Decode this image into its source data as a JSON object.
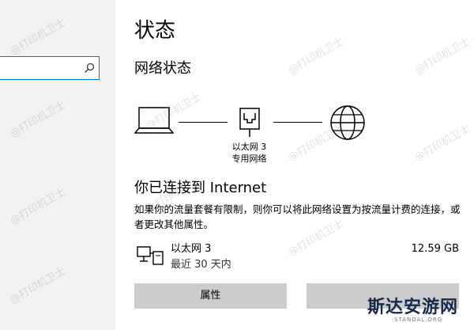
{
  "page": {
    "title": "状态",
    "section_title": "网络状态"
  },
  "diagram": {
    "adapter_name": "以太网 3",
    "network_type": "专用网络"
  },
  "status": {
    "heading": "你已连接到 Internet",
    "description": "如果你的流量套餐有限制，则你可以将此网络设置为按流量计费的连接，或者更改其他属性。"
  },
  "usage": {
    "adapter_name": "以太网 3",
    "period": "最近 30 天内",
    "amount": "12.59 GB"
  },
  "buttons": {
    "properties": "属性",
    "second": ""
  },
  "watermark": {
    "text": "@打印机卫士"
  },
  "brand": {
    "name": "斯达安游网",
    "sub": "STANDAL.ORG"
  },
  "colors": {
    "accent": "#0078d4",
    "sidebar": "#f2f2f2",
    "button": "#cccccc"
  }
}
